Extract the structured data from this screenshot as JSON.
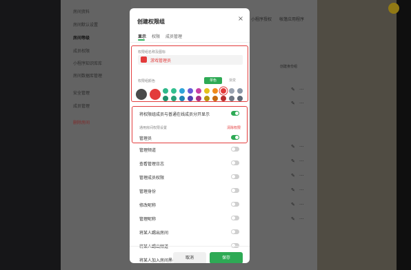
{
  "background": {
    "sidebar_items": [
      "房间资料",
      "房间默认设置",
      "房间等级",
      "成员权限",
      "小程序知识库库",
      "房间数据库管理",
      "安全管理",
      "成员管理",
      "删除房间"
    ],
    "active_index": 2,
    "top_right_links": [
      "小程序授权",
      "帐篷应用程序"
    ],
    "search_button": "创建身份组",
    "edit_icon": "✎",
    "more_icon": "···"
  },
  "modal": {
    "title": "创建权限组",
    "close_icon": "×",
    "tabs": [
      {
        "label": "显示",
        "active": true
      },
      {
        "label": "权限",
        "active": false
      },
      {
        "label": "成员管理",
        "active": false
      }
    ],
    "name_section_label": "权限组名称及图标",
    "name_value": "游戏管理员",
    "color_label": "权限组颜色",
    "color_mode": {
      "options": [
        "单色",
        "渐变"
      ],
      "selected": "单色"
    },
    "large_swatches": [
      "#4a4a4a",
      "#e33b3b"
    ],
    "color_dots_row1": [
      "#2fb88a",
      "#33c08f",
      "#2fa4d9",
      "#6a5bd6",
      "#c93fa5",
      "#e6c21a",
      "#f08a1c",
      "#e33b3b",
      "#9aa4b2",
      "#8a96a6"
    ],
    "color_dots_row2": [
      "#1f8f6a",
      "#28a078",
      "#2083b6",
      "#5240b0",
      "#a82f86",
      "#b8950f",
      "#c66a12",
      "#b82c2c",
      "#6f7885",
      "#5e6876"
    ],
    "selected_dot_index": 7,
    "show_separately_label": "将权限组成员与普通在线成员分开显示",
    "show_separately_on": true,
    "general_label": "通用房间权限设置",
    "reset_label": "清除权限",
    "admin_label": "管理员",
    "admin_on": true,
    "permissions": [
      {
        "label": "管理频道",
        "on": false
      },
      {
        "label": "查看管理日志",
        "on": false
      },
      {
        "label": "管理成员权限",
        "on": false
      },
      {
        "label": "管理身份",
        "on": false
      },
      {
        "label": "修改昵称",
        "on": false
      },
      {
        "label": "管理昵称",
        "on": false
      },
      {
        "label": "将某人踢出房间",
        "on": false
      },
      {
        "label": "将某人踢出频道",
        "on": false
      },
      {
        "label": "将某人加入房间黑名单",
        "on": false
      }
    ],
    "cancel_label": "取消",
    "save_label": "保存"
  }
}
